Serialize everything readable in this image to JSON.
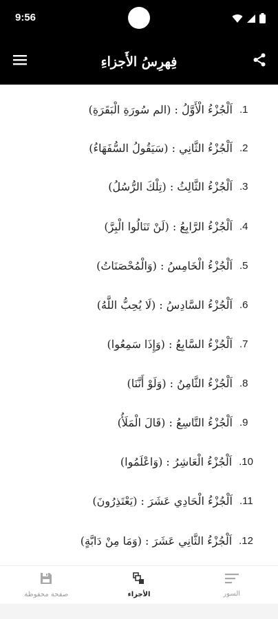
{
  "status_bar": {
    "time": "9:56"
  },
  "app_bar": {
    "title": "فِهرِسُ الأَجزاءِ",
    "menu_icon": "hamburger-menu-icon",
    "share_icon": "share-icon"
  },
  "juz_list": [
    {
      "number": ".1",
      "name": "اَلْجُزْءُ الْأَوَّلُ : (الم سُورَةِ الْبَقَرَةِ)"
    },
    {
      "number": ".2",
      "name": "اَلْجُزْءُ الثَّانِي : (سَيَقُولُ السُّفَهَاءُ)"
    },
    {
      "number": ".3",
      "name": "اَلْجُزْءُ الثَّالِثُ : (تِلْكَ الرُّسُلُ)"
    },
    {
      "number": ".4",
      "name": "اَلْجُزْءُ الرَّابِعُ : (لَنْ تَنَالُوا الْبِرَّ)"
    },
    {
      "number": ".5",
      "name": "اَلْجُزْءُ الْخَامِسُ : (وَالْمُحْصَنَاتُ)"
    },
    {
      "number": ".6",
      "name": "اَلْجُزْءُ السَّادِسُ : (لَا يُحِبُّ اللَّهُ)"
    },
    {
      "number": ".7",
      "name": "اَلْجُزْءُ السَّابِعُ : (وَإِذَا سَمِعُوا)"
    },
    {
      "number": ".8",
      "name": "اَلْجُزْءُ الثَّامِنُ : (وَلَوْ أَنَّنَا)"
    },
    {
      "number": ".9",
      "name": "اَلْجُزْءُ التَّاسِعُ : (قَالَ الْمَلَأُ)"
    },
    {
      "number": ".10",
      "name": "اَلْجُزْءُ الْعَاشِرُ : (وَاعْلَمُوا)"
    },
    {
      "number": ".11",
      "name": "اَلْجُزْءُ الْحَادِي عَشَرَ : (يَعْتَذِرُونَ)"
    },
    {
      "number": ".12",
      "name": "اَلْجُزْءُ الثَّانِي عَشَرَ : (وَمَا مِنْ دَابَّةٍ)"
    }
  ],
  "bottom_nav": {
    "items": [
      {
        "label": "صفحة محفوظة",
        "icon": "save-icon",
        "active": false
      },
      {
        "label": "الأجزاء",
        "icon": "juz-icon",
        "active": true
      },
      {
        "label": "السور",
        "icon": "surah-list-icon",
        "active": false
      }
    ]
  },
  "colors": {
    "bar_background": "#000000",
    "text": "#222222",
    "nav_inactive": "#9a9a9a",
    "nav_active": "#1a1a1a"
  }
}
